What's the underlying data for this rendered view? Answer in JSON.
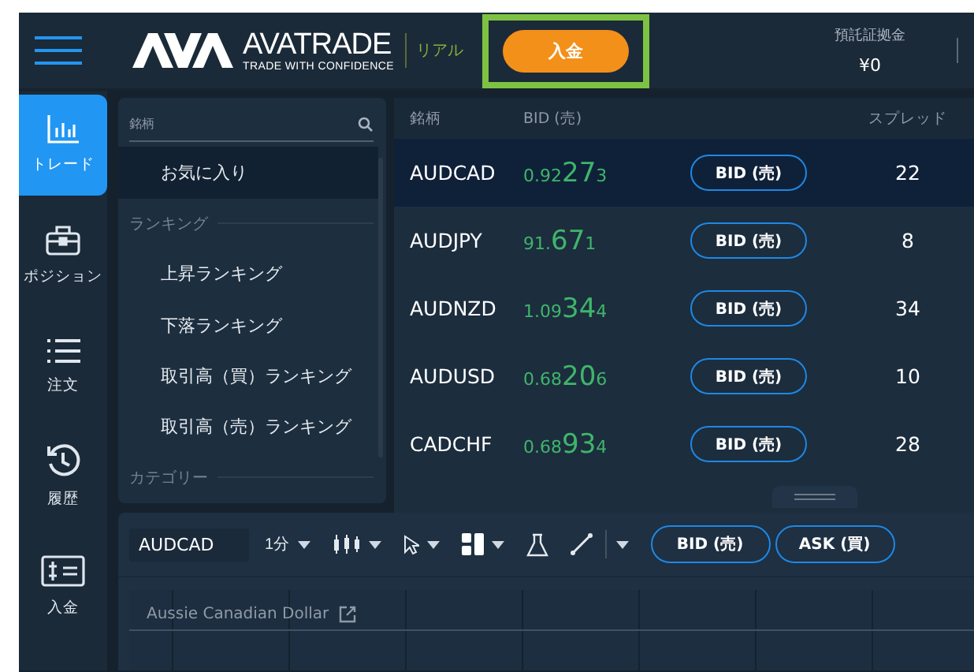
{
  "top_bar": {
    "brand": "AVATRADE",
    "tagline": "TRADE WITH CONFIDENCE",
    "account_type": "リアル",
    "deposit_button": {
      "label": "入金",
      "highlighted": true
    },
    "margin": {
      "label": "預託証拠金",
      "value": "¥0"
    }
  },
  "nav": [
    {
      "kind": "chart",
      "label": "トレード",
      "selected": true
    },
    {
      "kind": "briefcase",
      "label": "ポジション",
      "selected": false
    },
    {
      "kind": "list",
      "label": "注文",
      "selected": false
    },
    {
      "kind": "history",
      "label": "履歴",
      "selected": false
    },
    {
      "kind": "deposit",
      "label": "入金",
      "selected": false
    }
  ],
  "category_panel": {
    "search": {
      "placeholder": "銘柄"
    },
    "items": [
      {
        "kind": "item",
        "label": "お気に入り",
        "selected": true
      },
      {
        "kind": "heading",
        "label": "ランキング"
      },
      {
        "kind": "item",
        "label": "上昇ランキング",
        "selected": false
      },
      {
        "kind": "item",
        "label": "下落ランキング",
        "selected": false
      },
      {
        "kind": "item",
        "label": "取引高（買）ランキング",
        "selected": false
      },
      {
        "kind": "item",
        "label": "取引高（売）ランキング",
        "selected": false
      },
      {
        "kind": "heading",
        "label": "カテゴリー"
      }
    ]
  },
  "quotes": {
    "columns": [
      "銘柄",
      "BID (売)",
      "スプレッド"
    ],
    "rows": [
      {
        "symbol": "AUDCAD",
        "price": {
          "lead": "0.92",
          "big": "27",
          "tail": "3"
        },
        "button": "BID (売)",
        "spread": "22",
        "selected": true
      },
      {
        "symbol": "AUDJPY",
        "price": {
          "lead": "91.",
          "big": "67",
          "tail": "1"
        },
        "button": "BID (売)",
        "spread": "8",
        "selected": false
      },
      {
        "symbol": "AUDNZD",
        "price": {
          "lead": "1.09",
          "big": "34",
          "tail": "4"
        },
        "button": "BID (売)",
        "spread": "34",
        "selected": false
      },
      {
        "symbol": "AUDUSD",
        "price": {
          "lead": "0.68",
          "big": "20",
          "tail": "6"
        },
        "button": "BID (売)",
        "spread": "10",
        "selected": false
      },
      {
        "symbol": "CADCHF",
        "price": {
          "lead": "0.68",
          "big": "93",
          "tail": "4"
        },
        "button": "BID (売)",
        "spread": "28",
        "selected": false
      }
    ]
  },
  "chart": {
    "symbol": "AUDCAD",
    "interval": "1分",
    "buttons": [
      "BID (売)",
      "ASK (買)"
    ],
    "title": "Aussie Canadian Dollar"
  }
}
